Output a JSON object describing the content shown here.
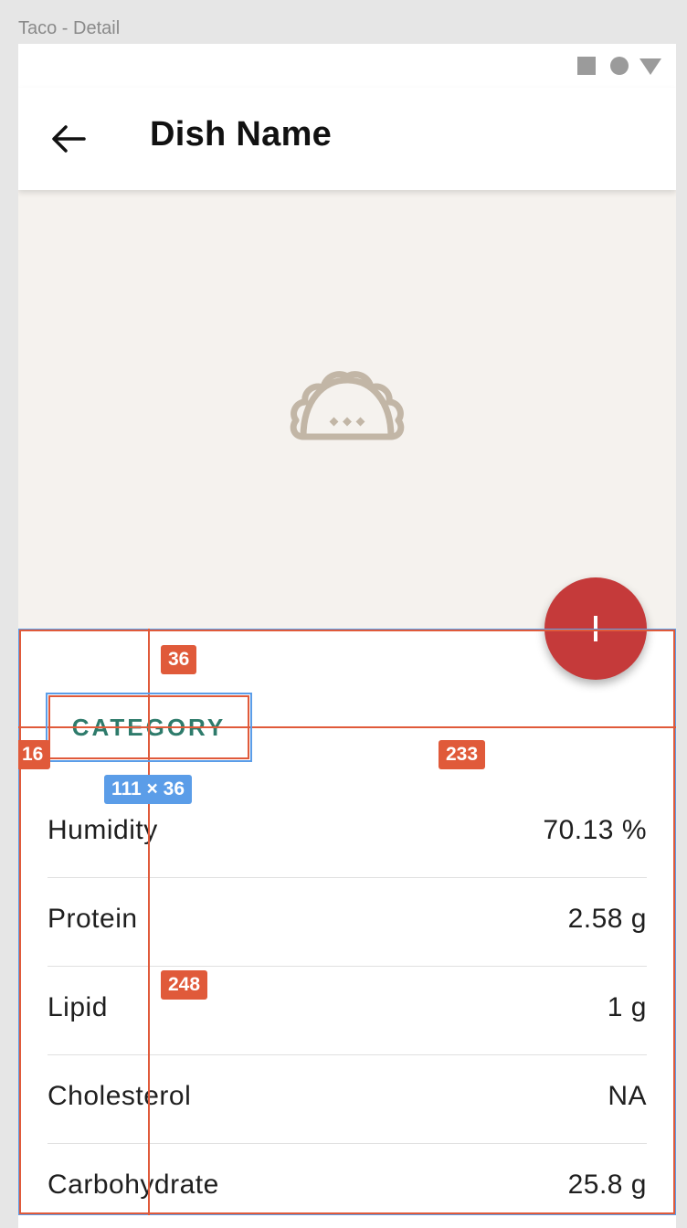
{
  "frame": {
    "title": "Taco - Detail"
  },
  "status_bar": {
    "icons": [
      "square-icon",
      "circle-icon",
      "triangle-icon"
    ]
  },
  "app_bar": {
    "back_icon": "arrow-left-icon",
    "title": "Dish Name"
  },
  "hero": {
    "icon": "taco-icon",
    "background_color": "#f5f2ee",
    "icon_color": "#c2b6a6"
  },
  "fab": {
    "icon": "plus-icon",
    "color": "#c53a3a"
  },
  "category": {
    "label": "CATEGORY",
    "color": "#2e7b6b"
  },
  "nutrients": [
    {
      "label": "Humidity",
      "value": "70.13 %"
    },
    {
      "label": "Protein",
      "value": "2.58 g"
    },
    {
      "label": "Lipid",
      "value": "1 g"
    },
    {
      "label": "Cholesterol",
      "value": "NA"
    },
    {
      "label": "Carbohydrate",
      "value": "25.8 g"
    }
  ],
  "spec_annotations": {
    "badges": [
      "36",
      "16",
      "233",
      "248"
    ],
    "size_label": "111 × 36",
    "redline_color": "#e05a3a",
    "blueline_color": "#5b9de8"
  }
}
